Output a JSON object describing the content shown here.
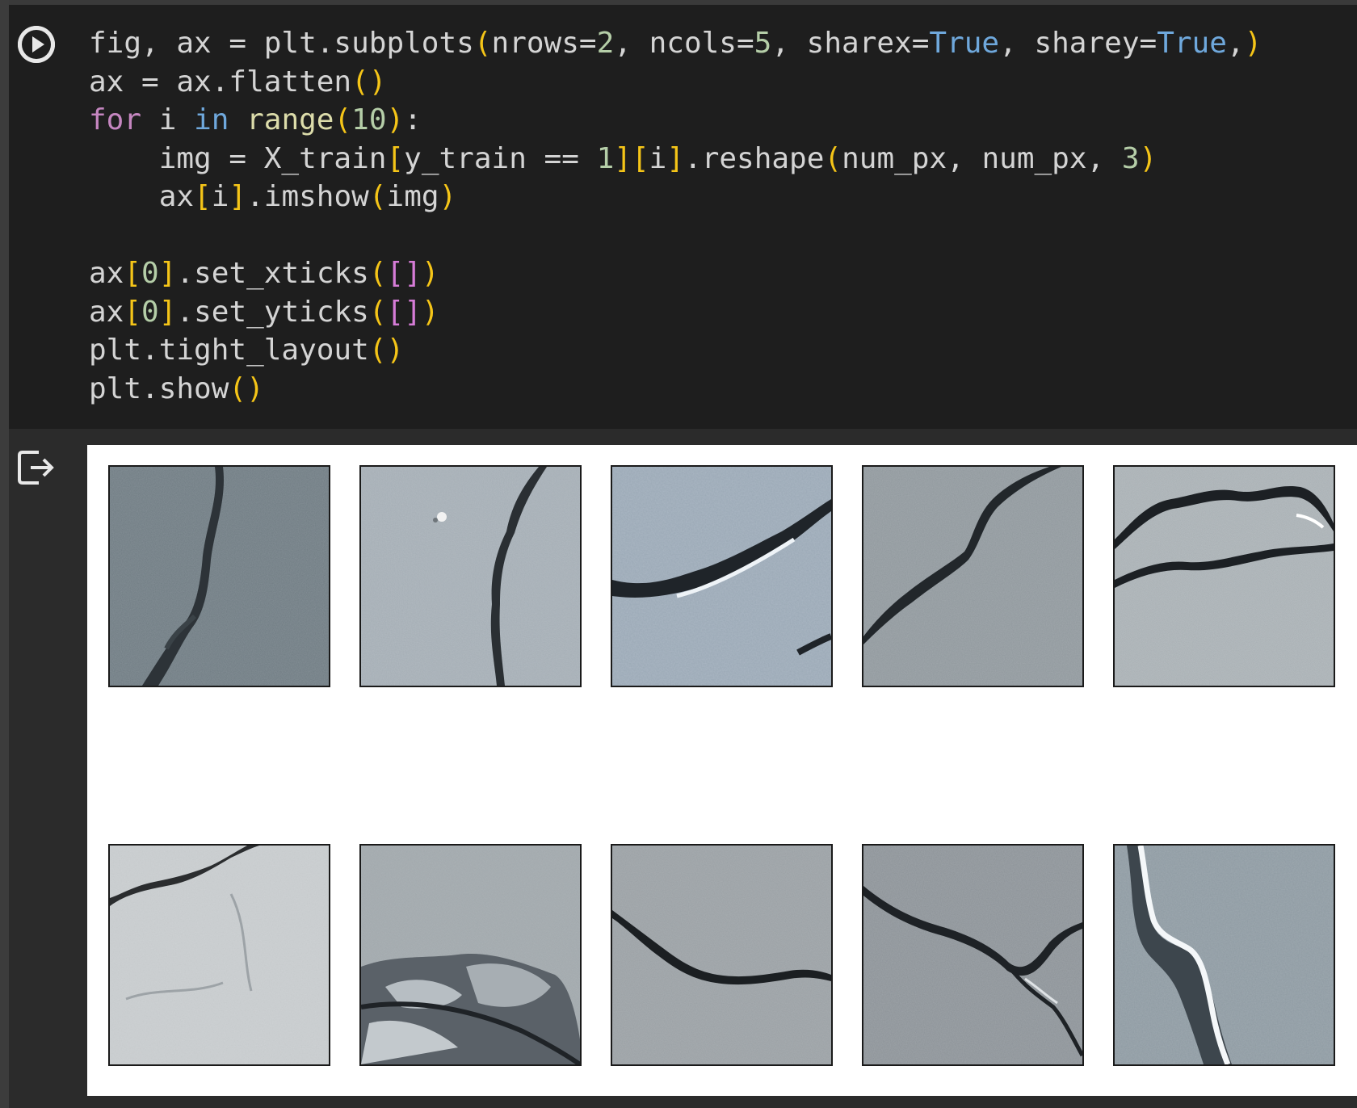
{
  "code_cell": {
    "lines": [
      "fig, ax = plt.subplots(nrows=2, ncols=5, sharex=True, sharey=True,)",
      "ax = ax.flatten()",
      "for i in range(10):",
      "    img = X_train[y_train == 1][i].reshape(num_px, num_px, 3)",
      "    ax[i].imshow(img)",
      "",
      "ax[0].set_xticks([])",
      "ax[0].set_yticks([])",
      "plt.tight_layout()",
      "plt.show()"
    ]
  },
  "buttons": {
    "run": "run-cell",
    "output": "output-actions"
  },
  "output": {
    "figure": {
      "rows": 2,
      "cols": 5,
      "panels": [
        {
          "index": 0,
          "subject": "concrete crack",
          "tone": "#6f7b82"
        },
        {
          "index": 1,
          "subject": "concrete crack",
          "tone": "#a4adb4"
        },
        {
          "index": 2,
          "subject": "concrete crack",
          "tone": "#9aa8b5"
        },
        {
          "index": 3,
          "subject": "concrete crack",
          "tone": "#8f979c"
        },
        {
          "index": 4,
          "subject": "concrete crack",
          "tone": "#a6adb1"
        },
        {
          "index": 5,
          "subject": "concrete crack",
          "tone": "#c6cacc"
        },
        {
          "index": 6,
          "subject": "concrete crack",
          "tone": "#9da4a8"
        },
        {
          "index": 7,
          "subject": "concrete crack",
          "tone": "#9aa0a4"
        },
        {
          "index": 8,
          "subject": "concrete crack",
          "tone": "#8c9297"
        },
        {
          "index": 9,
          "subject": "concrete crack",
          "tone": "#8e9aa2"
        }
      ]
    }
  }
}
